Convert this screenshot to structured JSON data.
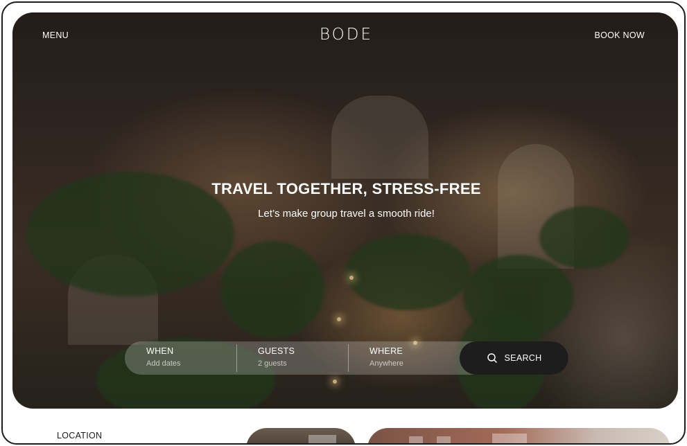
{
  "nav": {
    "menu_label": "MENU",
    "brand": "BODE",
    "book_label": "BOOK NOW"
  },
  "hero": {
    "headline": "TRAVEL TOGETHER, STRESS-FREE",
    "subheadline": "Let’s make group travel a smooth ride!"
  },
  "search": {
    "fields": [
      {
        "label": "WHEN",
        "placeholder": "Add dates"
      },
      {
        "label": "GUESTS",
        "placeholder": "2 guests"
      },
      {
        "label": "WHERE",
        "placeholder": "Anywhere"
      }
    ],
    "button_label": "SEARCH",
    "button_icon": "search-icon"
  },
  "below_fold": {
    "section_label": "LOCATION"
  },
  "colors": {
    "search_button_bg": "#1d1d1d",
    "text_on_hero": "#ffffff",
    "frame_border": "#1b1b1b"
  }
}
